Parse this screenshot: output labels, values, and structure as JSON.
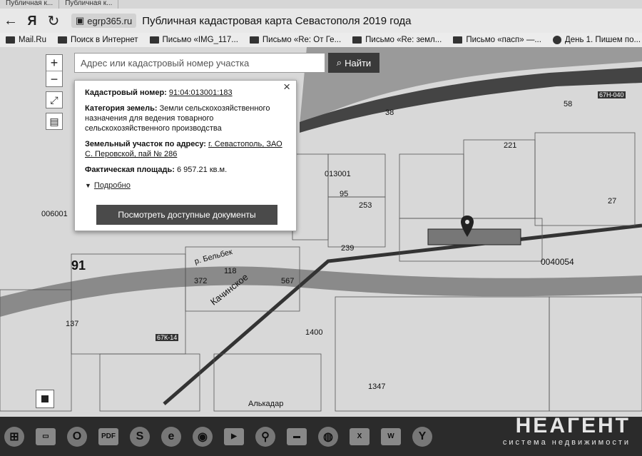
{
  "browser": {
    "tabs": [
      "Публичная к...",
      "Публичная к..."
    ],
    "url": "egrp365.ru",
    "page_title": "Публичная кадастровая карта Севастополя 2019 года",
    "bookmarks": [
      {
        "label": "Mail.Ru",
        "icon": "mailru-icon"
      },
      {
        "label": "Поиск в Интернет",
        "icon": "search-icon"
      },
      {
        "label": "Письмо «IMG_117...",
        "icon": "envelope-icon"
      },
      {
        "label": "Письмо «Re: От Ге...",
        "icon": "envelope-icon"
      },
      {
        "label": "Письмо «Re: земл...",
        "icon": "envelope-icon"
      },
      {
        "label": "Письмо «пасп» —...",
        "icon": "envelope-icon"
      },
      {
        "label": "День 1. Пишем по...",
        "icon": "play-icon"
      }
    ]
  },
  "map": {
    "search": {
      "placeholder": "Адрес или кадастровый номер участка",
      "button": "Найти"
    },
    "zoom_in": "+",
    "zoom_out": "−",
    "popup": {
      "cad_label": "Кадастровый номер:",
      "cad_value": "91:04:013001:183",
      "category_label": "Категория земель:",
      "category_value": "Земли сельскохозяйственного назначения для ведения товарного сельскохозяйственного производства",
      "address_label": "Земельный участок по адресу:",
      "address_value": "г. Севастополь, ЗАО С. Перовской, пай № 286",
      "area_label": "Фактическая площадь:",
      "area_value": "6 957.21 кв.м.",
      "more": "Подробно",
      "docs_button": "Посмотреть доступные документы"
    },
    "labels": {
      "quarter_013001": "013001",
      "quarter_006001": "006001",
      "quarter_004005": "0040054",
      "quarter_91": "91",
      "road_kachinskoe": "Качинское",
      "river": "р. Бельбек",
      "village": "Алькадар",
      "road_code_1": "67Н-040",
      "road_code_2": "67К-14",
      "plot_1347": "1347",
      "plot_1400": "1400",
      "plot_567": "567",
      "plot_38": "38",
      "plot_58": "58",
      "plot_221": "221",
      "plot_118": "118",
      "plot_372": "372",
      "plot_253": "253",
      "plot_95": "95",
      "plot_239": "239",
      "plot_27": "27",
      "plot_137": "137"
    }
  },
  "taskbar": {
    "watermark_title": "НЕАГЕНТ",
    "watermark_sub": "система недвижимости",
    "apps": [
      "start",
      "window",
      "opera",
      "pdf",
      "skype",
      "ie",
      "chrome",
      "media",
      "maps",
      "folder",
      "earth",
      "excel",
      "word",
      "yandex"
    ]
  }
}
